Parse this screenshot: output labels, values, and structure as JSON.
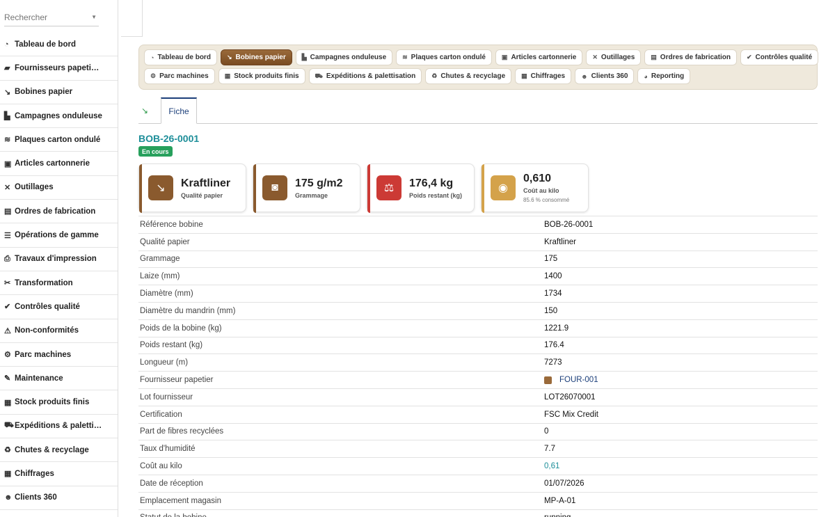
{
  "search": {
    "placeholder": "Rechercher"
  },
  "sidebar": {
    "items": [
      {
        "icon": "gauge-icon",
        "glyph": "◔",
        "label": "Tableau de bord"
      },
      {
        "icon": "truck-ramp-icon",
        "glyph": "▰",
        "label": "Fournisseurs papeti…"
      },
      {
        "icon": "hand-cart-icon",
        "glyph": "↘",
        "label": "Bobines papier"
      },
      {
        "icon": "industry-icon",
        "glyph": "▙",
        "label": "Campagnes onduleuse"
      },
      {
        "icon": "layers-icon",
        "glyph": "≋",
        "label": "Plaques carton ondulé"
      },
      {
        "icon": "box-icon",
        "glyph": "▣",
        "label": "Articles cartonnerie"
      },
      {
        "icon": "tools-icon",
        "glyph": "✕",
        "label": "Outillages"
      },
      {
        "icon": "clipboard-icon",
        "glyph": "▤",
        "label": "Ordres de fabrication"
      },
      {
        "icon": "list-icon",
        "glyph": "☰",
        "label": "Opérations de gamme"
      },
      {
        "icon": "print-icon",
        "glyph": "⎙",
        "label": "Travaux d'impression"
      },
      {
        "icon": "scissors-icon",
        "glyph": "✂",
        "label": "Transformation"
      },
      {
        "icon": "check-circle-icon",
        "glyph": "✔",
        "label": "Contrôles qualité"
      },
      {
        "icon": "warning-icon",
        "glyph": "⚠",
        "label": "Non-conformités"
      },
      {
        "icon": "gears-icon",
        "glyph": "⚙",
        "label": "Parc machines"
      },
      {
        "icon": "wrench-icon",
        "glyph": "✎",
        "label": "Maintenance"
      },
      {
        "icon": "warehouse-icon",
        "glyph": "▦",
        "label": "Stock produits finis"
      },
      {
        "icon": "truck-icon",
        "glyph": "⛟",
        "label": "Expéditions & paletti…"
      },
      {
        "icon": "recycle-icon",
        "glyph": "♻",
        "label": "Chutes & recyclage"
      },
      {
        "icon": "calculator-icon",
        "glyph": "▦",
        "label": "Chiffrages"
      },
      {
        "icon": "users-icon",
        "glyph": "☻",
        "label": "Clients 360"
      }
    ]
  },
  "nav": {
    "row1": [
      {
        "icon": "gauge-icon",
        "glyph": "◔",
        "label": "Tableau de bord",
        "active": false
      },
      {
        "icon": "hand-cart-icon",
        "glyph": "↘",
        "label": "Bobines papier",
        "active": true
      },
      {
        "icon": "industry-icon",
        "glyph": "▙",
        "label": "Campagnes onduleuse",
        "active": false
      },
      {
        "icon": "layers-icon",
        "glyph": "≋",
        "label": "Plaques carton ondulé",
        "active": false
      },
      {
        "icon": "box-icon",
        "glyph": "▣",
        "label": "Articles cartonnerie",
        "active": false
      },
      {
        "icon": "tools-icon",
        "glyph": "✕",
        "label": "Outillages",
        "active": false
      },
      {
        "icon": "clipboard-icon",
        "glyph": "▤",
        "label": "Ordres de fabrication",
        "active": false
      },
      {
        "icon": "check-circle-icon",
        "glyph": "✔",
        "label": "Contrôles qualité",
        "active": false
      }
    ],
    "row2": [
      {
        "icon": "gears-icon",
        "glyph": "⚙",
        "label": "Parc machines",
        "active": false
      },
      {
        "icon": "warehouse-icon",
        "glyph": "▦",
        "label": "Stock produits finis",
        "active": false
      },
      {
        "icon": "truck-icon",
        "glyph": "⛟",
        "label": "Expéditions & palettisation",
        "active": false
      },
      {
        "icon": "recycle-icon",
        "glyph": "♻",
        "label": "Chutes & recyclage",
        "active": false
      },
      {
        "icon": "calculator-icon",
        "glyph": "▦",
        "label": "Chiffrages",
        "active": false
      },
      {
        "icon": "users-icon",
        "glyph": "☻",
        "label": "Clients 360",
        "active": false
      },
      {
        "icon": "chart-pie-icon",
        "glyph": "◕",
        "label": "Reporting",
        "active": false
      }
    ]
  },
  "tabs": {
    "fiche_label": "Fiche"
  },
  "record": {
    "title": "BOB-26-0001",
    "status": "En cours"
  },
  "kpis": [
    {
      "icon": "hand-cart-icon",
      "glyph": "↘",
      "value": "Kraftliner",
      "label": "Qualité papier",
      "color": "#8a5a2e",
      "bar": "#8a5a2e"
    },
    {
      "icon": "weight-gauge-icon",
      "glyph": "◙",
      "value": "175 g/m2",
      "label": "Grammage",
      "color": "#8a5a2e",
      "bar": "#8a5a2e"
    },
    {
      "icon": "scale-icon",
      "glyph": "⚖",
      "value": "176,4 kg",
      "label": "Poids restant (kg)",
      "color": "#cc3a35",
      "bar": "#cc3a35"
    },
    {
      "icon": "coins-icon",
      "glyph": "◉",
      "value": "0,610",
      "label": "Coût au kilo",
      "sub": "85.6 % consommé",
      "color": "#d4a24a",
      "bar": "#d4a24a"
    }
  ],
  "details": [
    {
      "label": "Référence bobine",
      "value": "BOB-26-0001"
    },
    {
      "label": "Qualité papier",
      "value": "Kraftliner"
    },
    {
      "label": "Grammage",
      "value": "175"
    },
    {
      "label": "Laize (mm)",
      "value": "1400"
    },
    {
      "label": "Diamètre (mm)",
      "value": "1734"
    },
    {
      "label": "Diamètre du mandrin (mm)",
      "value": "150"
    },
    {
      "label": "Poids de la bobine (kg)",
      "value": "1221.9"
    },
    {
      "label": "Poids restant (kg)",
      "value": "176.4"
    },
    {
      "label": "Longueur (m)",
      "value": "7273"
    },
    {
      "label": "Fournisseur papetier",
      "value": "FOUR-001",
      "kind": "link"
    },
    {
      "label": "Lot fournisseur",
      "value": "LOT26070001"
    },
    {
      "label": "Certification",
      "value": "FSC Mix Credit"
    },
    {
      "label": "Part de fibres recyclées",
      "value": "0"
    },
    {
      "label": "Taux d'humidité",
      "value": "7.7"
    },
    {
      "label": "Coût au kilo",
      "value": "0,61",
      "kind": "teal"
    },
    {
      "label": "Date de réception",
      "value": "01/07/2026"
    },
    {
      "label": "Emplacement magasin",
      "value": "MP-A-01"
    },
    {
      "label": "Statut de la bobine",
      "value": "running"
    }
  ]
}
